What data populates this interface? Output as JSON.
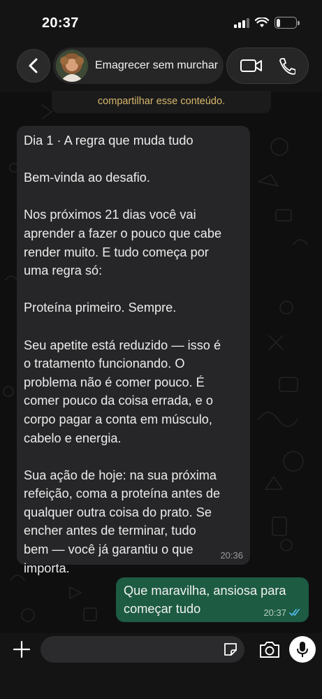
{
  "status_bar": {
    "time": "20:37",
    "battery": "27"
  },
  "header": {
    "contact_name": "Emagrecer sem murchar",
    "icons": [
      "back-chevron-icon",
      "video-call-icon",
      "phone-call-icon"
    ]
  },
  "chat": {
    "system_note": "compartilhar esse conteúdo.",
    "incoming": {
      "lines": [
        "Dia 1 · A regra que muda tudo",
        "",
        "Bem-vinda ao desafio.",
        "",
        "Nos próximos 21 dias você vai",
        "aprender a fazer o pouco que cabe",
        "render muito. E tudo começa por",
        "uma regra só:",
        "",
        "Proteína primeiro. Sempre.",
        "",
        "Seu apetite está reduzido — isso é",
        "o tratamento funcionando. O",
        "problema não é comer pouco. É",
        "comer pouco da coisa errada, e o",
        "corpo pagar a conta em músculo,",
        "cabelo e energia.",
        "",
        "Sua ação de hoje: na sua próxima",
        "refeição, coma a proteína antes de",
        "qualquer outra coisa do prato. Se",
        "encher antes de terminar, tudo",
        "bem — você já garantiu o que",
        "importa."
      ],
      "time": "20:36"
    },
    "outgoing": {
      "lines": [
        "Que maravilha, ansiosa para",
        "começar tudo"
      ],
      "time": "20:37",
      "status": "read"
    }
  },
  "input_bar": {
    "placeholder": "",
    "icons": [
      "plus-icon",
      "sticker-icon",
      "camera-icon",
      "microphone-icon"
    ]
  },
  "colors": {
    "background": "#0f0f10",
    "incoming_bubble": "#262628",
    "outgoing_bubble": "#1d5b43",
    "system_note_text": "#d8b76a",
    "read_ticks": "#53bdeb"
  }
}
